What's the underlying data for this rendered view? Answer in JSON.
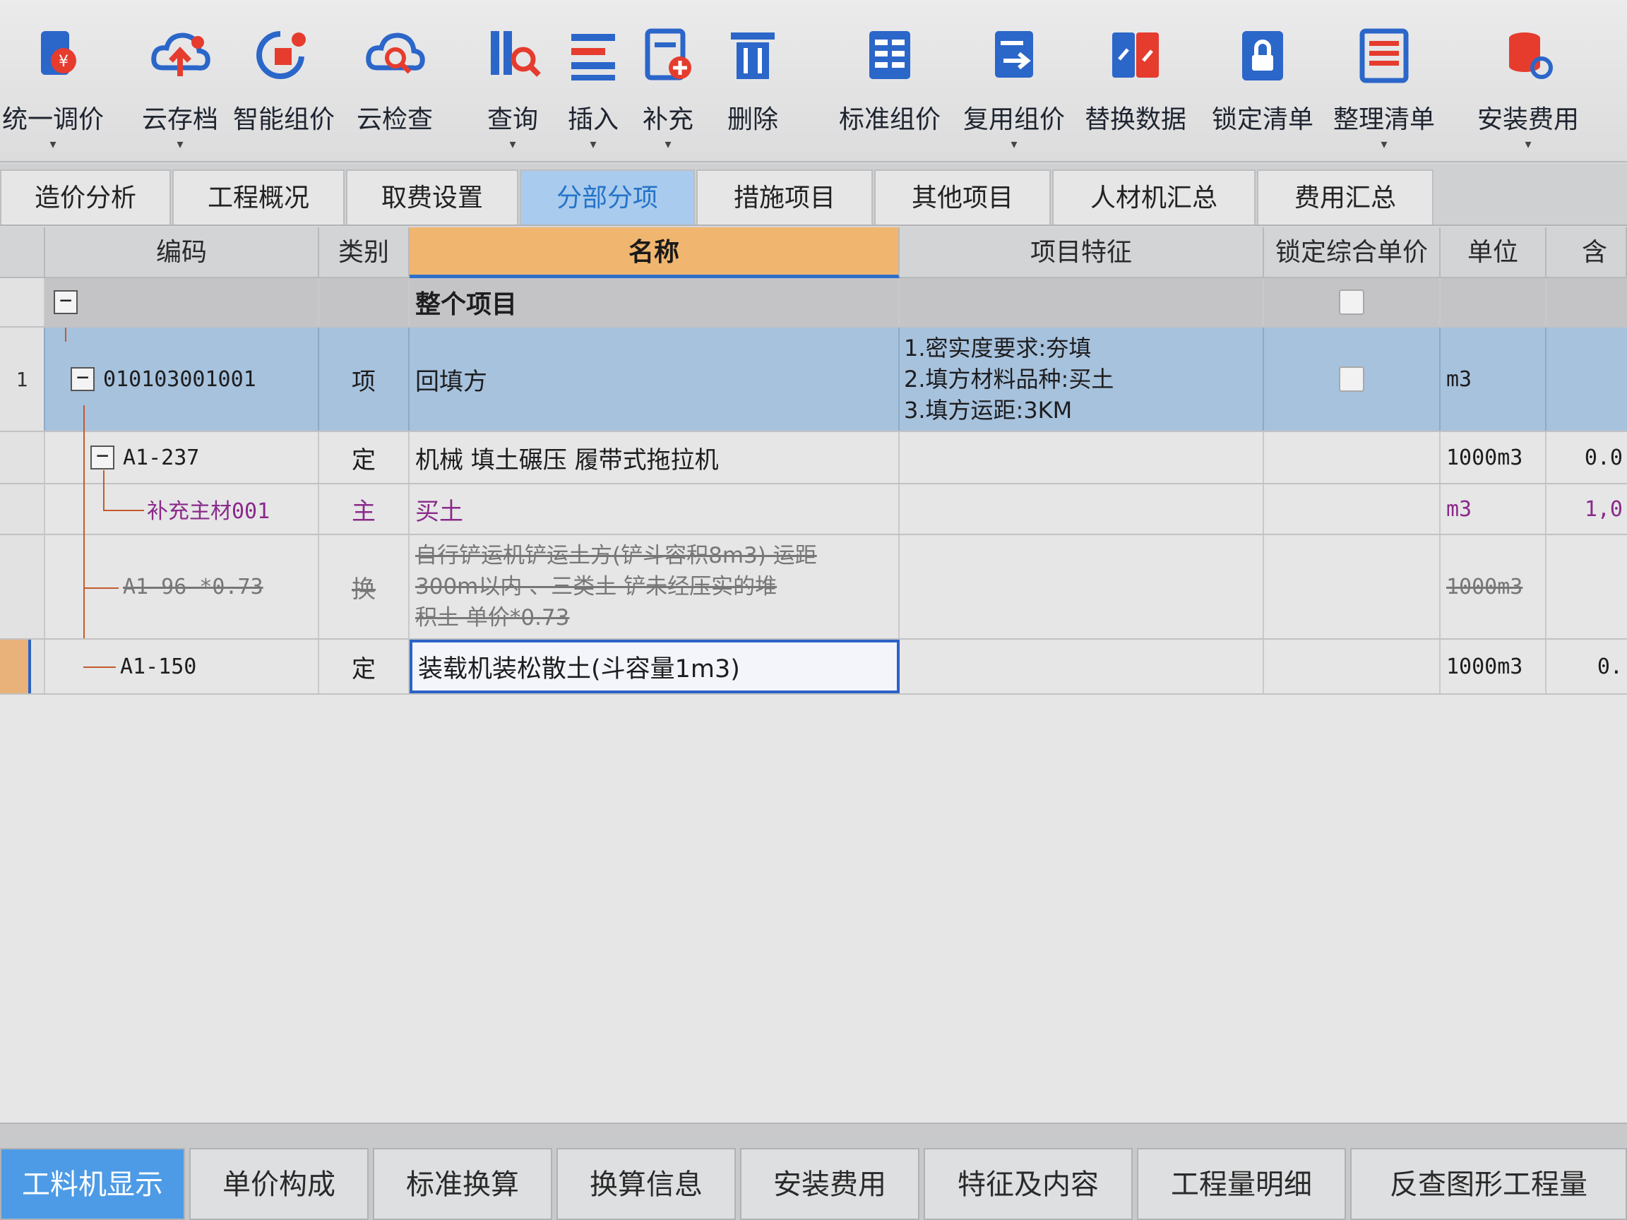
{
  "toolbar": {
    "buttons": [
      {
        "label": "统一调价",
        "icon": "unified-price-icon",
        "caret": "▾"
      },
      {
        "label": "云存档",
        "icon": "cloud-save-icon",
        "caret": "▾"
      },
      {
        "label": "智能组价",
        "icon": "smart-pricing-icon",
        "caret": ""
      },
      {
        "label": "云检查",
        "icon": "cloud-check-icon",
        "caret": ""
      },
      {
        "label": "查询",
        "icon": "query-icon",
        "caret": "▾"
      },
      {
        "label": "插入",
        "icon": "insert-icon",
        "caret": "▾"
      },
      {
        "label": "补充",
        "icon": "supplement-icon",
        "caret": "▾"
      },
      {
        "label": "删除",
        "icon": "delete-icon",
        "caret": ""
      },
      {
        "label": "标准组价",
        "icon": "standard-pricing-icon",
        "caret": ""
      },
      {
        "label": "复用组价",
        "icon": "reuse-pricing-icon",
        "caret": "▾"
      },
      {
        "label": "替换数据",
        "icon": "replace-data-icon",
        "caret": ""
      },
      {
        "label": "锁定清单",
        "icon": "lock-list-icon",
        "caret": ""
      },
      {
        "label": "整理清单",
        "icon": "organize-list-icon",
        "caret": "▾"
      },
      {
        "label": "安装费用",
        "icon": "install-fee-icon",
        "caret": "▾"
      }
    ]
  },
  "main_tabs": [
    {
      "label": "造价分析",
      "active": false
    },
    {
      "label": "工程概况",
      "active": false
    },
    {
      "label": "取费设置",
      "active": false
    },
    {
      "label": "分部分项",
      "active": true
    },
    {
      "label": "措施项目",
      "active": false
    },
    {
      "label": "其他项目",
      "active": false
    },
    {
      "label": "人材机汇总",
      "active": false
    },
    {
      "label": "费用汇总",
      "active": false
    }
  ],
  "columns": {
    "code": "编码",
    "type": "类别",
    "name": "名称",
    "features": "项目特征",
    "lock_price": "锁定综合单价",
    "unit": "单位",
    "qty": "含"
  },
  "rows": {
    "group": {
      "name": "整个项目",
      "expander": "−"
    },
    "item": {
      "num": "1",
      "expander": "−",
      "code": "010103001001",
      "type": "项",
      "name": "回填方",
      "features": [
        "1.密实度要求:夯填",
        "2.填方材料品种:买土",
        "3.填方运距:3KM"
      ],
      "unit": "m3",
      "qty": ""
    },
    "quota1": {
      "expander": "−",
      "code": "A1-237",
      "type": "定",
      "name": "机械 填土碾压 履带式拖拉机",
      "unit": "1000m3",
      "qty": "0.0"
    },
    "material": {
      "code": "补充主材001",
      "type": "主",
      "name": "买土",
      "unit": "m3",
      "qty": "1,0"
    },
    "quota_disabled": {
      "code": "A1-96 *0.73",
      "type": "换",
      "name_lines": [
        "自行铲运机铲运土方(铲斗容积8m3) 运距",
        "300m以内  、三类土  铲未经压实的堆",
        "积土 单价*0.73"
      ],
      "unit": "1000m3",
      "qty": ""
    },
    "quota2": {
      "code": "A1-150",
      "type": "定",
      "name": "装载机装松散土(斗容量1m3)",
      "unit": "1000m3",
      "qty": "0."
    }
  },
  "bottom_tabs": [
    {
      "label": "工料机显示",
      "active": true
    },
    {
      "label": "单价构成",
      "active": false
    },
    {
      "label": "标准换算",
      "active": false
    },
    {
      "label": "换算信息",
      "active": false
    },
    {
      "label": "安装费用",
      "active": false
    },
    {
      "label": "特征及内容",
      "active": false
    },
    {
      "label": "工程量明细",
      "active": false
    },
    {
      "label": "反查图形工程量",
      "active": false
    }
  ],
  "colors": {
    "accent": "#2573c9",
    "active_tab_bg": "#a9cbed",
    "header_active": "#f0b66f",
    "qd_row": "#a7c2dd",
    "main_material": "#8a2a8a"
  }
}
